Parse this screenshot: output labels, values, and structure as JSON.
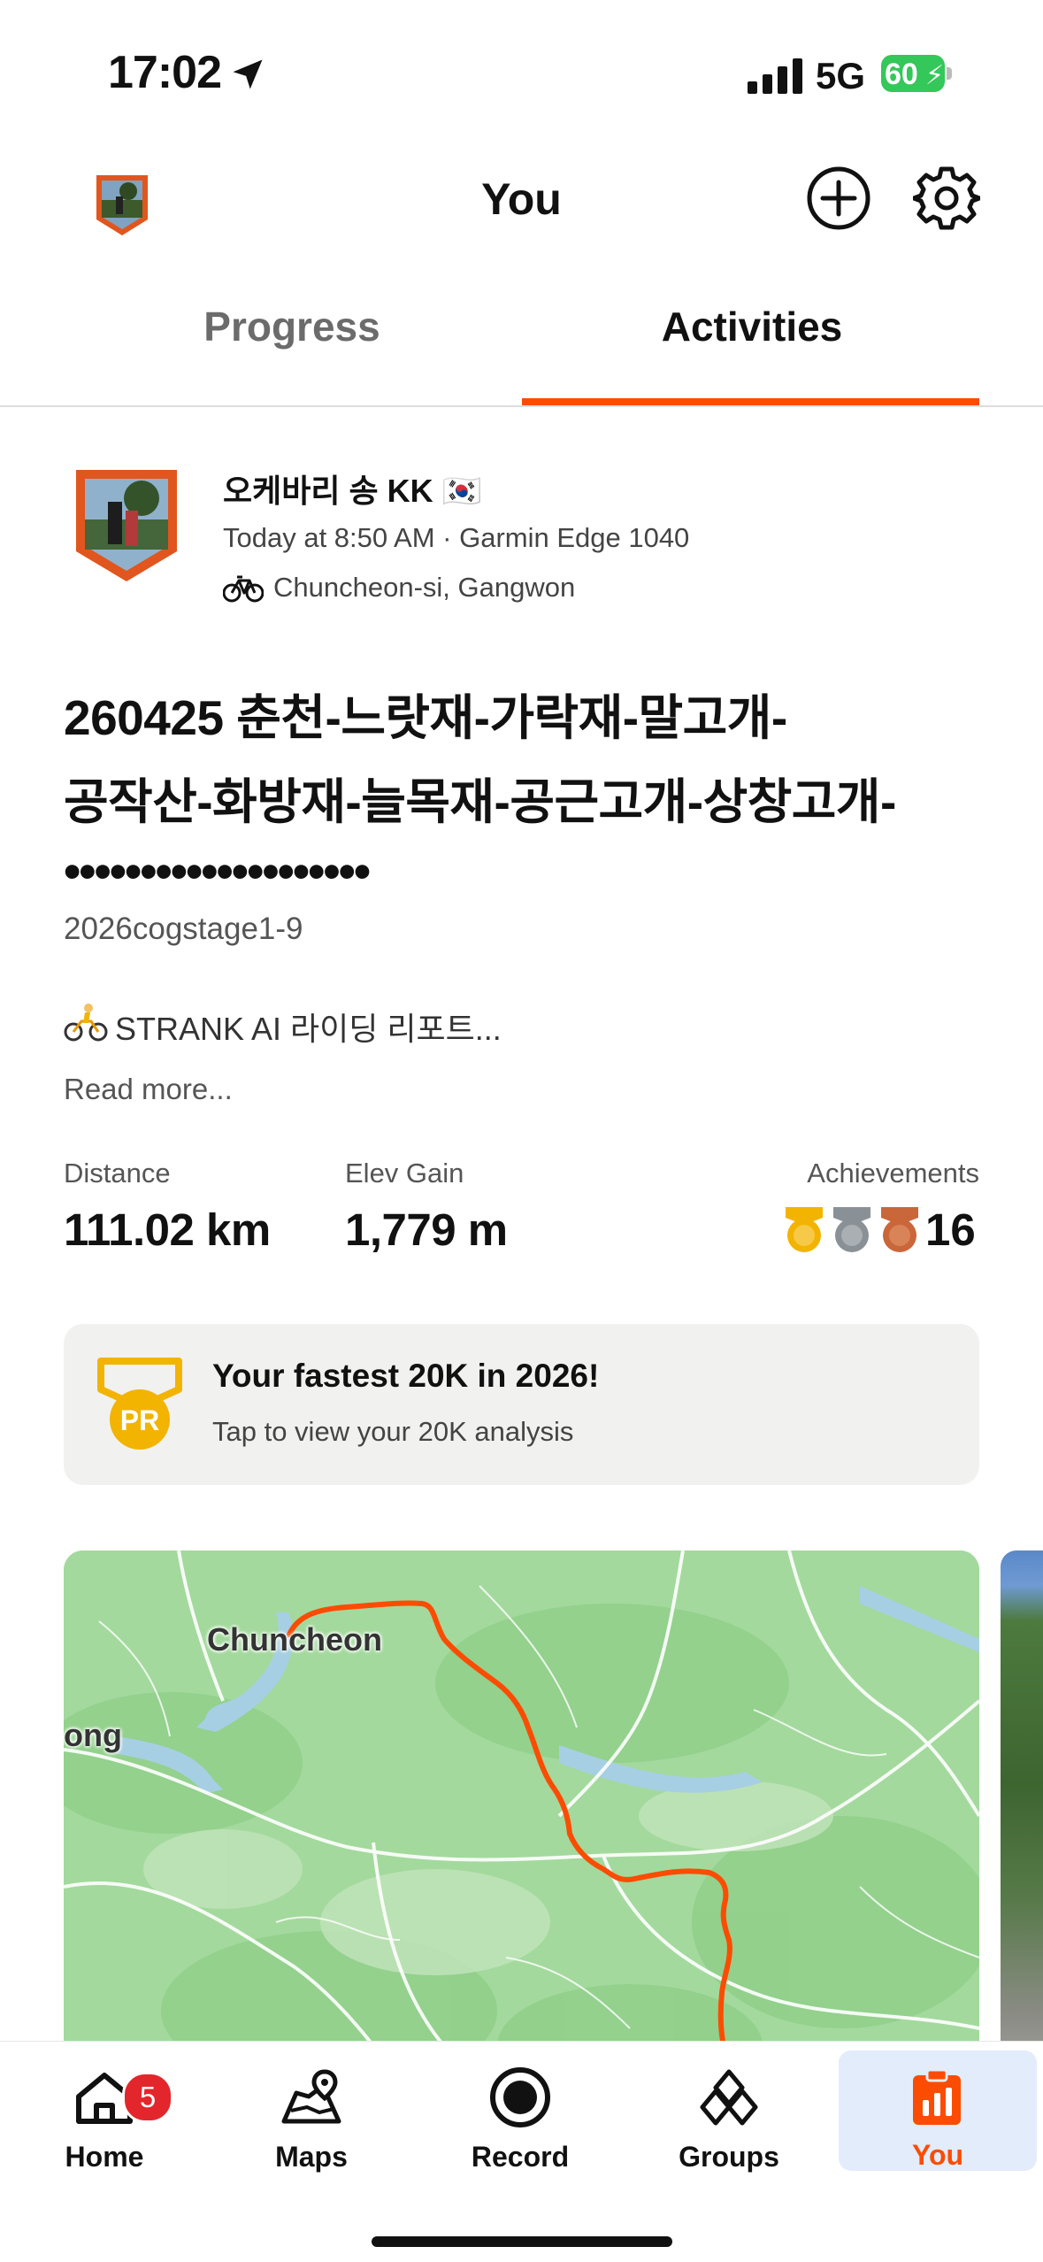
{
  "status_bar": {
    "time": "17:02",
    "network": "5G",
    "battery": "60"
  },
  "header": {
    "title": "You"
  },
  "tabs": [
    {
      "label": "Progress",
      "selected": false
    },
    {
      "label": "Activities",
      "selected": true
    }
  ],
  "activity": {
    "athlete_name": "오케바리 송 KK",
    "flag": "🇰🇷",
    "meta": "Today at 8:50 AM · Garmin Edge 1040",
    "location": "Chuncheon-si, Gangwon",
    "title_line1": "260425 춘천-느랏재-가락재-말고개-",
    "title_line2": "공작산-화방재-늘목재-공근고개-상창고개-",
    "title_line3": "••••••••••••••••••••",
    "tag": "2026cogstage1-9",
    "description": "STRANK AI 라이딩 리포트...",
    "read_more": "Read more...",
    "stats": {
      "distance_label": "Distance",
      "distance_value": "111.02 km",
      "elev_label": "Elev Gain",
      "elev_value": "1,779 m",
      "achievements_label": "Achievements",
      "achievements_value": "16"
    },
    "pr_card": {
      "badge_text": "PR",
      "title": "Your fastest 20K in 2026!",
      "subtitle": "Tap to view your 20K analysis"
    },
    "map": {
      "labels": [
        "Chuncheon",
        "ong"
      ]
    }
  },
  "tab_bar": {
    "items": [
      {
        "label": "Home",
        "icon": "home-icon",
        "badge": "5"
      },
      {
        "label": "Maps",
        "icon": "maps-icon"
      },
      {
        "label": "Record",
        "icon": "record-icon"
      },
      {
        "label": "Groups",
        "icon": "groups-icon"
      },
      {
        "label": "You",
        "icon": "you-icon",
        "selected": true
      }
    ]
  },
  "colors": {
    "accent": "#fc4c02",
    "selected_tab_bg": "#e3ecfa",
    "badge_red": "#e2262b",
    "battery_green": "#34c759",
    "map_green": "#9fd79a"
  }
}
